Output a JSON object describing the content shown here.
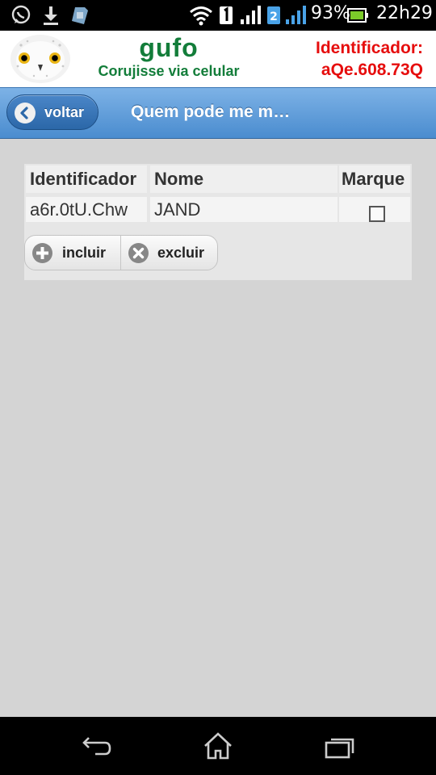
{
  "status_bar": {
    "sim_slot": "2",
    "battery": "93%",
    "time": "22h29",
    "icons": [
      "whatsapp-icon",
      "download-icon",
      "sim-card-icon",
      "wifi-icon",
      "sim1-badge-icon",
      "signal-icon",
      "sim2-badge-icon",
      "signal-icon",
      "battery-icon"
    ]
  },
  "header": {
    "brand": "gufo",
    "tagline": "Corujisse via celular",
    "ident_label": "Identificador:",
    "ident_value": "aQe.608.73Q",
    "logo": "owl-logo",
    "colors": {
      "brand": "#137d3a",
      "ident": "#e60d0d"
    }
  },
  "navbar": {
    "back_label": "voltar",
    "title": "Quem pode me m…",
    "colors": {
      "bar": "#5d9ad8"
    }
  },
  "table": {
    "columns": [
      "Identificador",
      "Nome",
      "Marque"
    ],
    "rows": [
      {
        "identificador": "a6r.0tU.Chw",
        "nome": "JAND",
        "marque": false
      }
    ]
  },
  "actions": {
    "include_label": "incluir",
    "exclude_label": "excluir",
    "include_icon": "plus-circle-icon",
    "exclude_icon": "x-circle-icon"
  },
  "system_nav": {
    "keys": [
      "back-icon",
      "home-icon",
      "recent-apps-icon"
    ]
  }
}
